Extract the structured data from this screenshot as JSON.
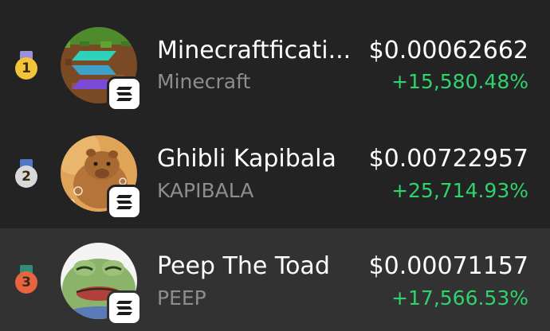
{
  "tokens": [
    {
      "rank": "1",
      "name": "Minecraftficati...",
      "ticker": "Minecraft",
      "price": "$0.00062662",
      "change": "+15,580.48%",
      "medal": {
        "ribbon": "#9c8fd9",
        "coin": "#f3c33a"
      },
      "avatar_icon": "minecraft-solana-avatar",
      "chain_icon": "solana-icon"
    },
    {
      "rank": "2",
      "name": "Ghibli Kapibala",
      "ticker": "KAPIBALA",
      "price": "$0.00722957",
      "change": "+25,714.93%",
      "medal": {
        "ribbon": "#4f78c8",
        "coin": "#d9d9d9"
      },
      "avatar_icon": "capybara-avatar",
      "chain_icon": "solana-icon"
    },
    {
      "rank": "3",
      "name": "Peep The Toad",
      "ticker": "PEEP",
      "price": "$0.00071157",
      "change": "+17,566.53%",
      "medal": {
        "ribbon": "#2f8c7a",
        "coin": "#e8643e"
      },
      "avatar_icon": "toad-avatar",
      "chain_icon": "solana-icon"
    }
  ]
}
